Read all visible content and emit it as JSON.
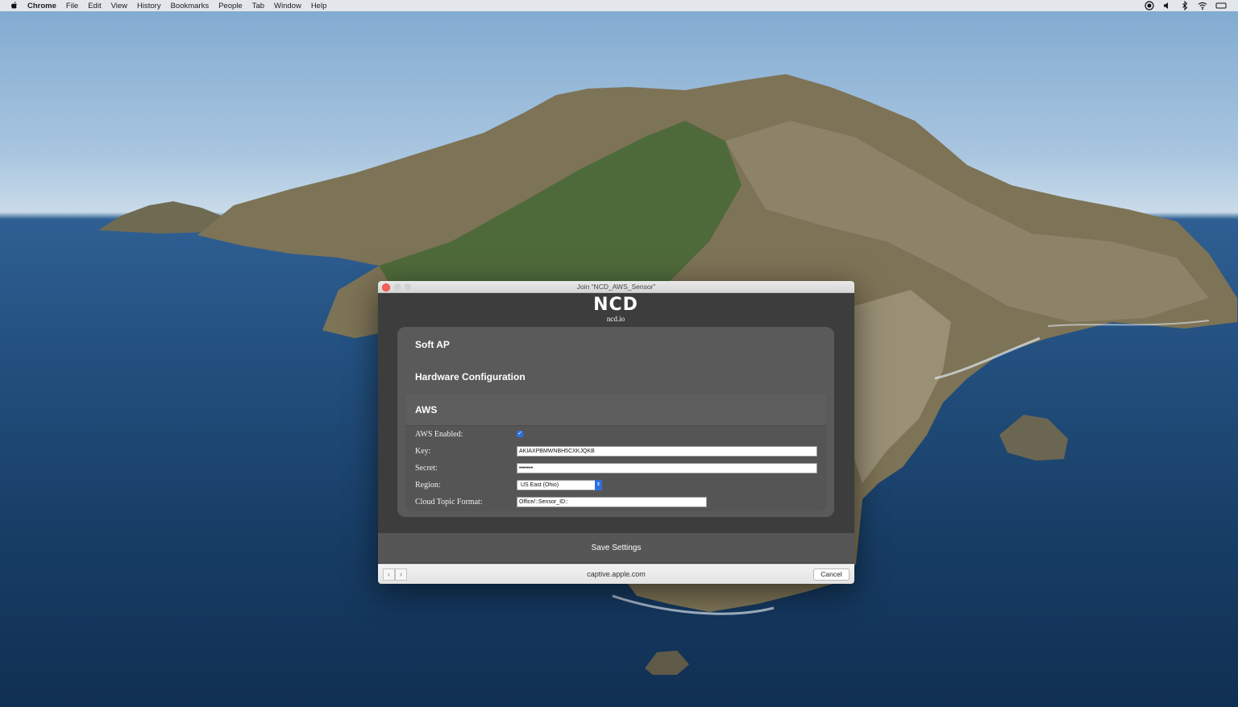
{
  "menubar": {
    "app_name": "Chrome",
    "items": [
      "File",
      "Edit",
      "View",
      "History",
      "Bookmarks",
      "People",
      "Tab",
      "Window",
      "Help"
    ]
  },
  "window": {
    "title": "Join “NCD_AWS_Sensor”",
    "logo_mark": "NCD",
    "logo_sub": "ncd.io",
    "sections": {
      "soft_ap": "Soft AP",
      "hardware_config": "Hardware Configuration",
      "aws": "AWS"
    },
    "form": {
      "aws_enabled_label": "AWS Enabled:",
      "aws_enabled": true,
      "key_label": "Key:",
      "key_value": "AKIAXPBMWNBH5CXKJQKB",
      "secret_label": "Secret:",
      "secret_value": "•••••••",
      "region_label": "Region:",
      "region_value": "US East (Ohio)",
      "topic_label": "Cloud Topic Format:",
      "topic_value": "Office/::Sensor_ID::"
    },
    "save_label": "Save Settings",
    "url": "captive.apple.com",
    "cancel_label": "Cancel"
  },
  "colors": {
    "accent": "#2d6fe0",
    "close_light": "#ff5f57",
    "panel": "#5a5a5a",
    "window_bg": "#3d3d3d"
  }
}
